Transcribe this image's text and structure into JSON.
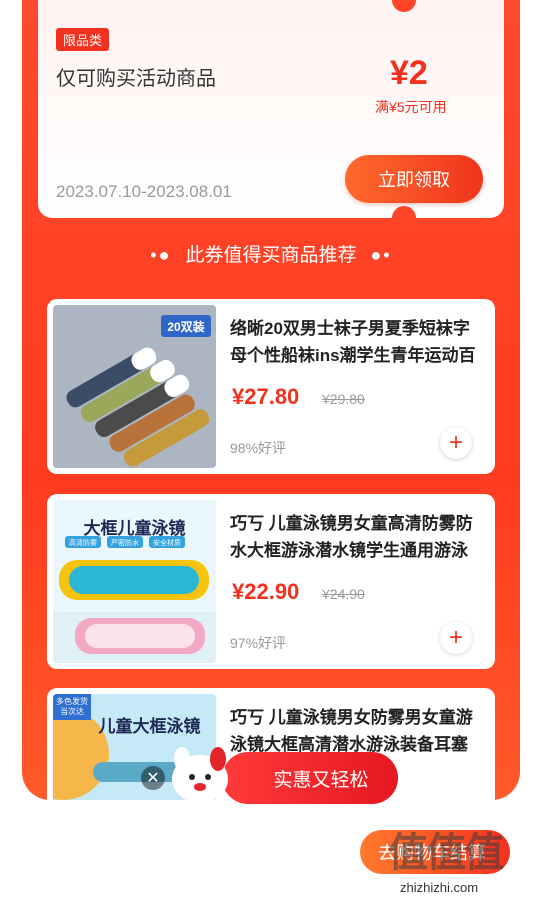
{
  "coupon": {
    "tag": "限品类",
    "title": "仅可购买活动商品",
    "amount": "¥2",
    "condition": "满¥5元可用",
    "date_range": "2023.07.10-2023.08.01",
    "claim_label": "立即领取"
  },
  "section": {
    "title": "此券值得买商品推荐",
    "dots": "•●"
  },
  "products": [
    {
      "title": "络晰20双男士袜子男夏季短袜字母个性船袜ins潮学生青年运动百",
      "price": "¥27.80",
      "old_price": "¥29.80",
      "rating": "98%好评",
      "thumb_badge": "20双装"
    },
    {
      "title": "巧丂 儿童泳镜男女童高清防雾防水大框游泳潜水镜学生通用游泳",
      "price": "¥22.90",
      "old_price": "¥24.90",
      "rating": "97%好评",
      "thumb_label": "大框儿童泳镜",
      "thumb_chips": [
        "高清防雾",
        "严密防水",
        "安全材质"
      ]
    },
    {
      "title": "巧丂 儿童泳镜男女防雾男女童游泳镜大框高清潜水游泳装备耳塞",
      "thumb_label": "儿童大框泳镜",
      "thumb_badge": "多色发货 当次达"
    }
  ],
  "floating": {
    "banner_label": "实惠又轻松",
    "close": "✕"
  },
  "bottom": {
    "button_label": "去购物车结算"
  },
  "watermark": {
    "big": "值值值",
    "small": "zhizhizhi.com"
  },
  "colors": {
    "accent": "#f2311f",
    "panel": "#ff4a2e"
  },
  "icons": {
    "plus": "plus-icon",
    "close": "close-icon"
  }
}
